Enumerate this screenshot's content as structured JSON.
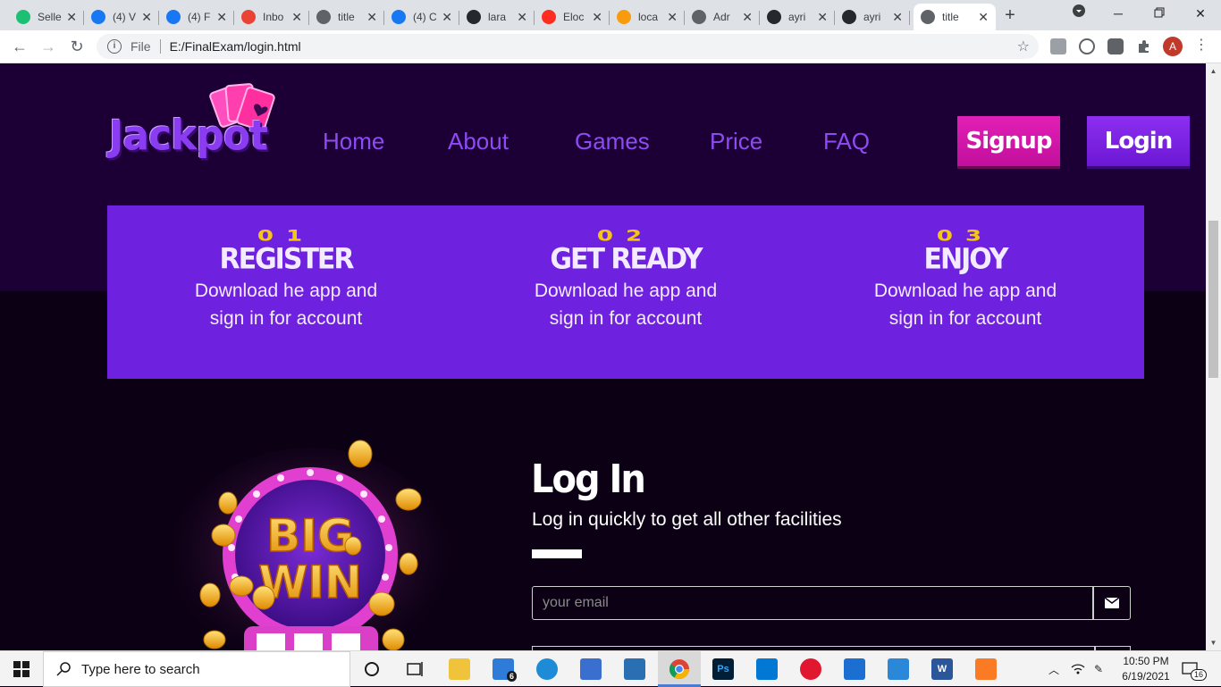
{
  "browser": {
    "tabs": [
      {
        "favicon": "fiverr-icon",
        "favicon_color": "#1dbf73",
        "title": "Selle"
      },
      {
        "favicon": "facebook-icon",
        "favicon_color": "#1877f2",
        "title": "(4) V"
      },
      {
        "favicon": "facebook-icon",
        "favicon_color": "#1877f2",
        "title": "(4) F"
      },
      {
        "favicon": "gmail-icon",
        "favicon_color": "#ea4335",
        "title": "Inbo"
      },
      {
        "favicon": "globe-icon",
        "favicon_color": "#5f6368",
        "title": "title"
      },
      {
        "favicon": "facebook-icon",
        "favicon_color": "#1877f2",
        "title": "(4) C"
      },
      {
        "favicon": "github-icon",
        "favicon_color": "#24292e",
        "title": "lara"
      },
      {
        "favicon": "laravel-icon",
        "favicon_color": "#ff2d20",
        "title": "Eloc"
      },
      {
        "favicon": "phpmyadmin-icon",
        "favicon_color": "#f89c0e",
        "title": "loca"
      },
      {
        "favicon": "globe-icon",
        "favicon_color": "#5f6368",
        "title": "Adr"
      },
      {
        "favicon": "github-icon",
        "favicon_color": "#24292e",
        "title": "ayri"
      },
      {
        "favicon": "github-icon",
        "favicon_color": "#24292e",
        "title": "ayri"
      },
      {
        "favicon": "globe-icon",
        "favicon_color": "#5f6368",
        "title": "title",
        "active": true
      }
    ],
    "address": {
      "scheme_label": "File",
      "url": "E:/FinalExam/login.html"
    },
    "profile_initial": "A"
  },
  "site": {
    "logo_text": "Jackpot",
    "nav": [
      "Home",
      "About",
      "Games",
      "Price",
      "FAQ"
    ],
    "signup_label": "Signup",
    "login_label": "Login",
    "colors": {
      "nav_link": "#8e4bf3",
      "signup": "#d11aa8",
      "login": "#7b25e6",
      "steps_panel": "#6f21e0",
      "step_number": "#f5c518"
    },
    "steps": [
      {
        "number": "01",
        "title": "REGISTER",
        "text": "Download he app and sign in for account"
      },
      {
        "number": "02",
        "title": "GET READY",
        "text": "Download he app and sign in for account"
      },
      {
        "number": "03",
        "title": "ENJOY",
        "text": "Download he app and sign in for account"
      }
    ],
    "bigwin_line1": "BIG",
    "bigwin_line2": "WIN",
    "login_form": {
      "title": "Log In",
      "subtitle": "Log in quickly to get all other facilities",
      "email_placeholder": "your email"
    }
  },
  "taskbar": {
    "search_placeholder": "Type here to search",
    "mail_badge": "6",
    "time": "10:50 PM",
    "date": "6/19/2021",
    "notification_count": "16"
  }
}
